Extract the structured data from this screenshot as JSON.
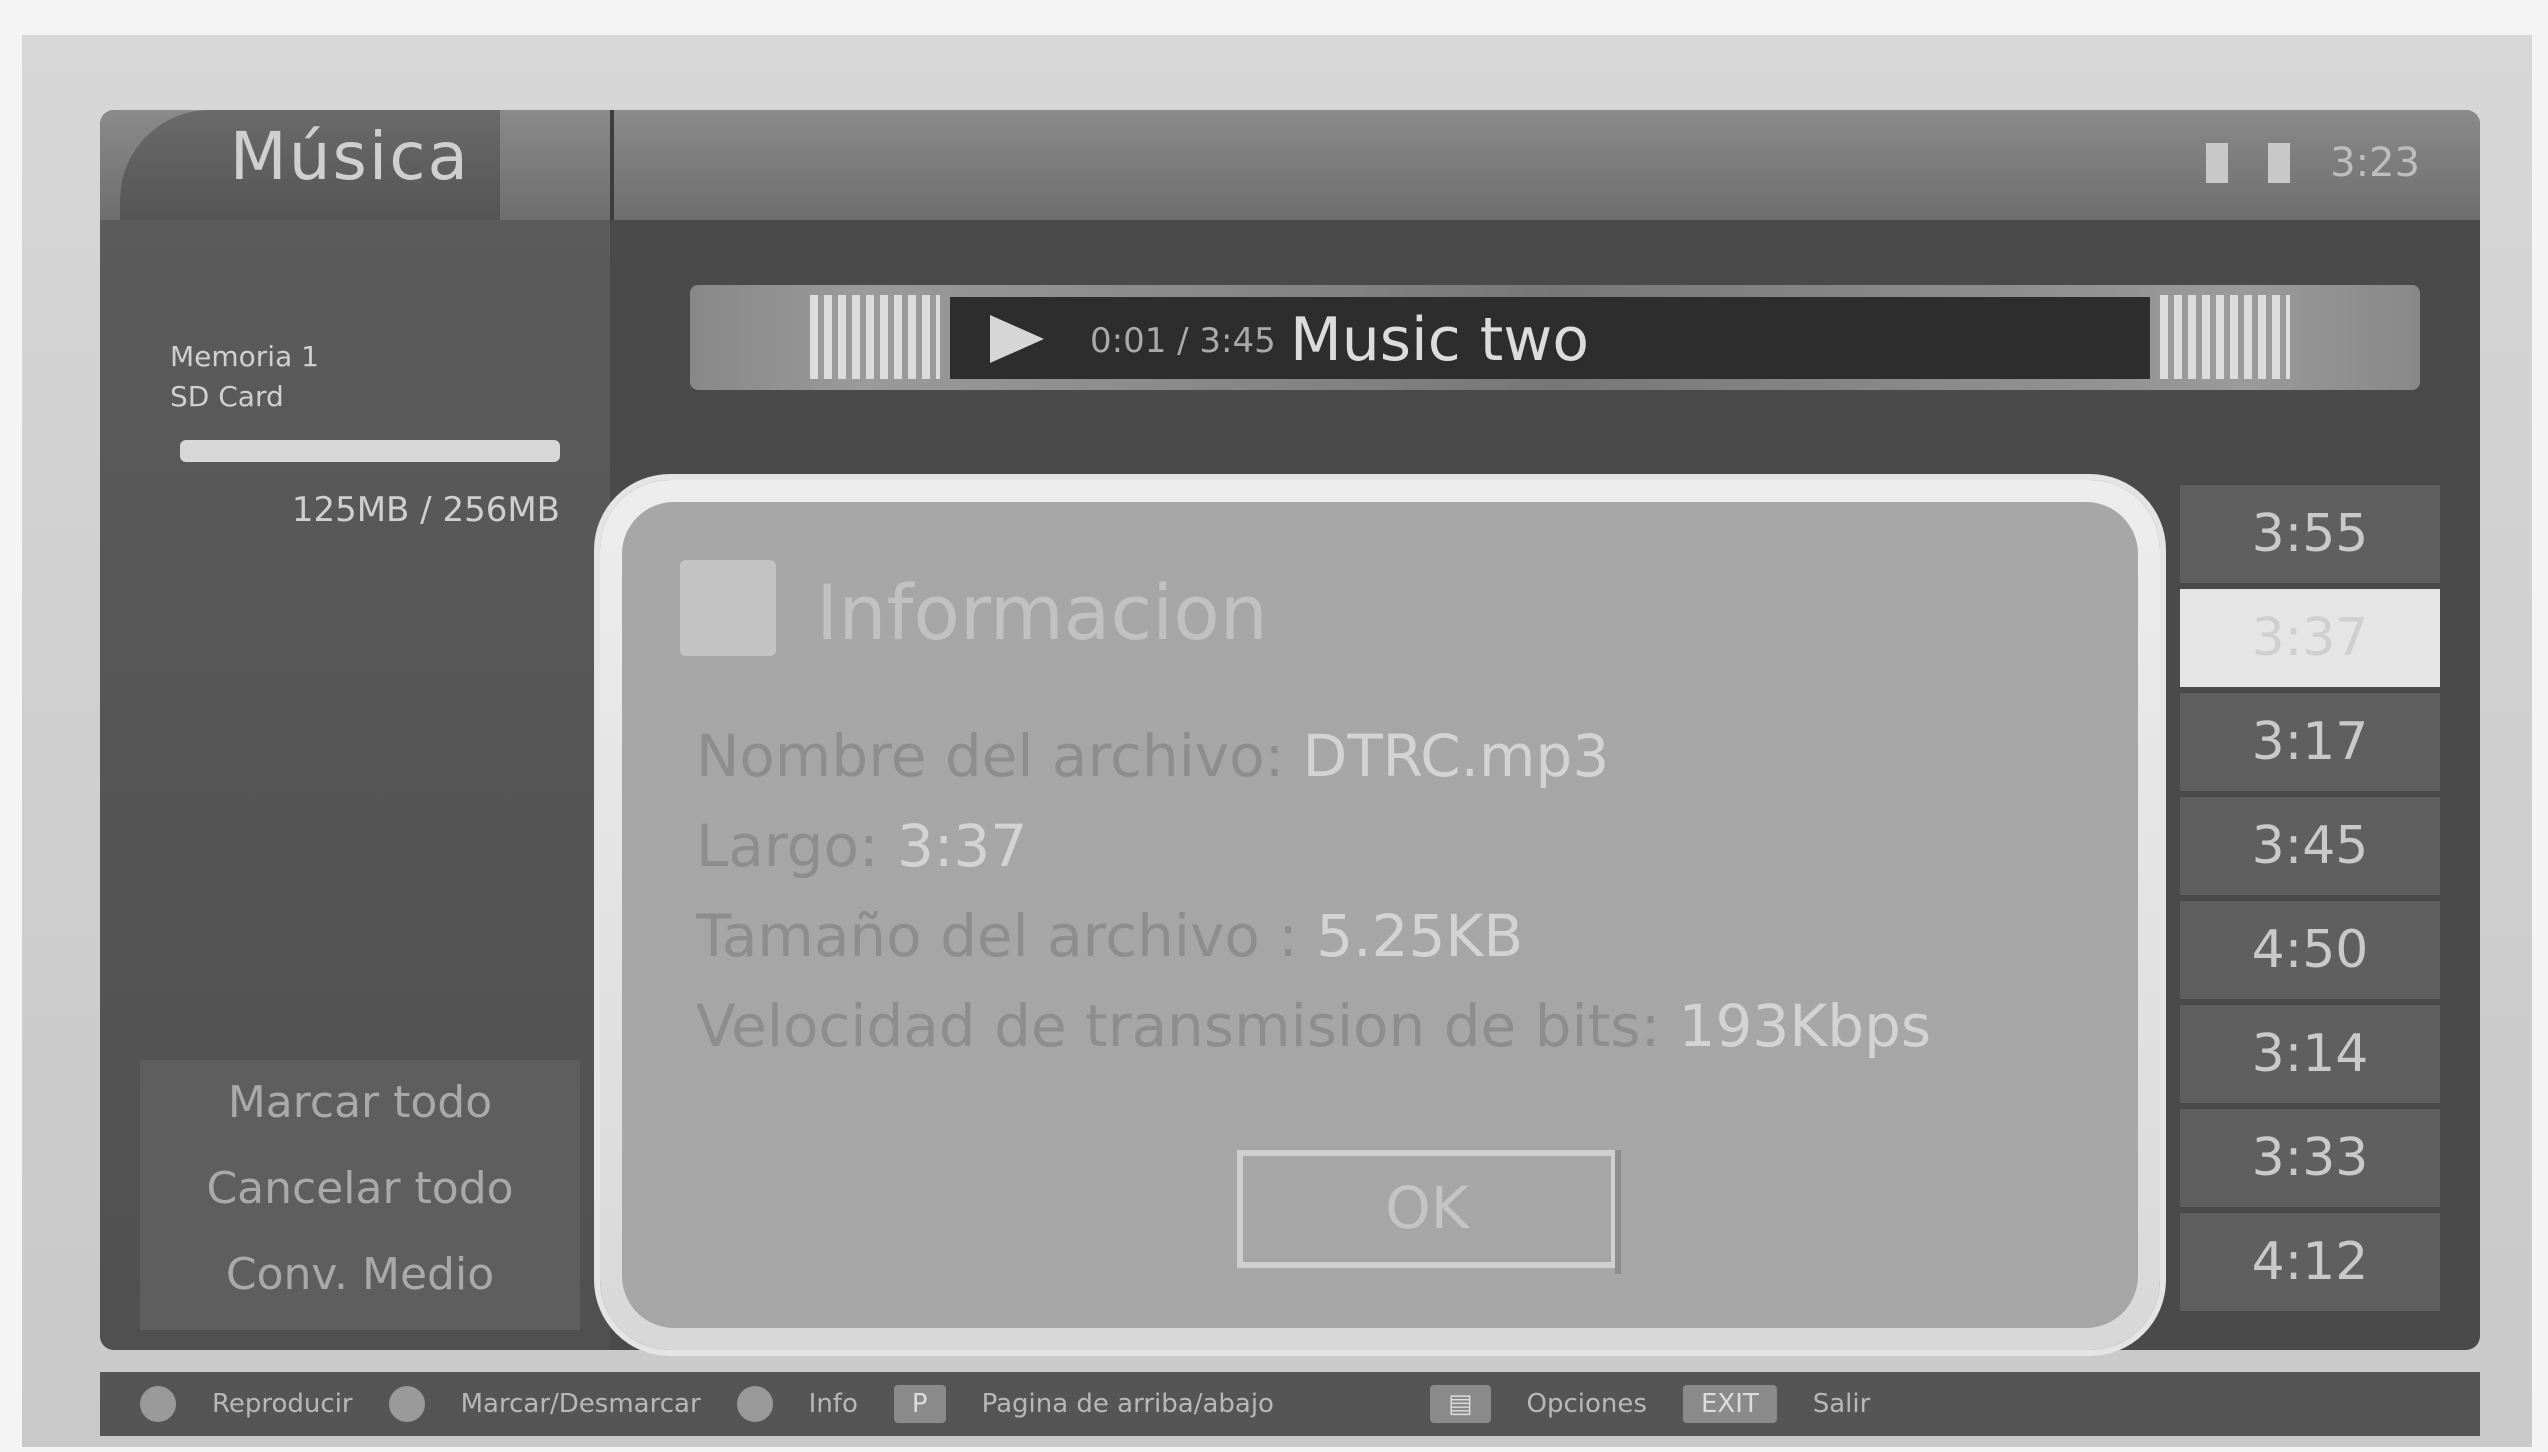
{
  "sidebar": {
    "title": "Música",
    "memory_label": "Memoria 1",
    "memory_sublabel": "SD Card",
    "memory_size": "125MB / 256MB",
    "menu": [
      "Marcar todo",
      "Cancelar todo",
      "Conv. Medio"
    ]
  },
  "status_bar": {
    "time": "3:23"
  },
  "now_playing": {
    "time": "0:01 / 3:45",
    "title": "Music two"
  },
  "durations": [
    "3:55",
    "3:37",
    "3:17",
    "3:45",
    "4:50",
    "3:14",
    "3:33",
    "4:12"
  ],
  "modal": {
    "title": "Informacion",
    "lines": [
      {
        "label": "Nombre del archivo: ",
        "value": "DTRC.mp3"
      },
      {
        "label": "Largo: ",
        "value": "3:37"
      },
      {
        "label": "Tamaño del archivo : ",
        "value": "5.25KB"
      },
      {
        "label": "Velocidad de transmision de bits: ",
        "value": "193Kbps"
      }
    ],
    "ok_label": "OK"
  },
  "help_bar": {
    "items": [
      "Reproducir",
      "Marcar/Desmarcar",
      "Info",
      "Pagina de arriba/abajo",
      "Opciones",
      "Salir"
    ],
    "key_page": "P",
    "key_exit": "EXIT"
  }
}
